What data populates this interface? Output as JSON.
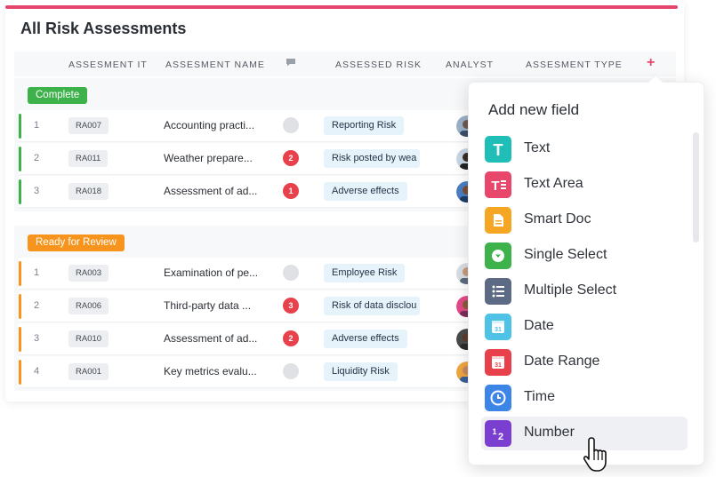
{
  "page": {
    "title": "All Risk Assessments"
  },
  "columns": {
    "id": "ASSESMENT IT",
    "name": "ASSESMENT NAME",
    "risk": "ASSESSED RISK",
    "analyst": "ANALYST",
    "type": "ASSESMENT TYPE",
    "add": "+"
  },
  "groups": [
    {
      "status": "Complete",
      "color": "#3db24a",
      "rows": [
        {
          "num": "1",
          "id": "RA007",
          "name": "Accounting practi...",
          "comments": "",
          "risk": "Reporting Risk"
        },
        {
          "num": "2",
          "id": "RA011",
          "name": "Weather prepare...",
          "comments": "2",
          "risk": "Risk posted by wea"
        },
        {
          "num": "3",
          "id": "RA018",
          "name": "Assessment of ad...",
          "comments": "1",
          "risk": "Adverse effects"
        }
      ]
    },
    {
      "status": "Ready for Review",
      "color": "#f7941d",
      "rows": [
        {
          "num": "1",
          "id": "RA003",
          "name": "Examination of pe...",
          "comments": "",
          "risk": "Employee Risk"
        },
        {
          "num": "2",
          "id": "RA006",
          "name": "Third-party data ...",
          "comments": "3",
          "risk": "Risk of data disclou"
        },
        {
          "num": "3",
          "id": "RA010",
          "name": "Assessment of ad...",
          "comments": "2",
          "risk": "Adverse effects"
        },
        {
          "num": "4",
          "id": "RA001",
          "name": "Key metrics evalu...",
          "comments": "",
          "risk": "Liquidity Risk"
        }
      ]
    }
  ],
  "dropdown": {
    "title": "Add new field",
    "items": [
      {
        "label": "Text",
        "icon": "text-icon",
        "color": "#1fbfb8"
      },
      {
        "label": "Text Area",
        "icon": "text-area-icon",
        "color": "#e8466b"
      },
      {
        "label": "Smart Doc",
        "icon": "doc-icon",
        "color": "#f5a623"
      },
      {
        "label": "Single Select",
        "icon": "dropdown-icon",
        "color": "#3db24a"
      },
      {
        "label": "Multiple Select",
        "icon": "list-icon",
        "color": "#5d6a83"
      },
      {
        "label": "Date",
        "icon": "calendar-icon",
        "color": "#4ec3e6"
      },
      {
        "label": "Date Range",
        "icon": "calendar-range-icon",
        "color": "#e8414c"
      },
      {
        "label": "Time",
        "icon": "clock-icon",
        "color": "#3d86e8"
      },
      {
        "label": "Number",
        "icon": "number-icon",
        "color": "#7a3fd1"
      }
    ]
  }
}
